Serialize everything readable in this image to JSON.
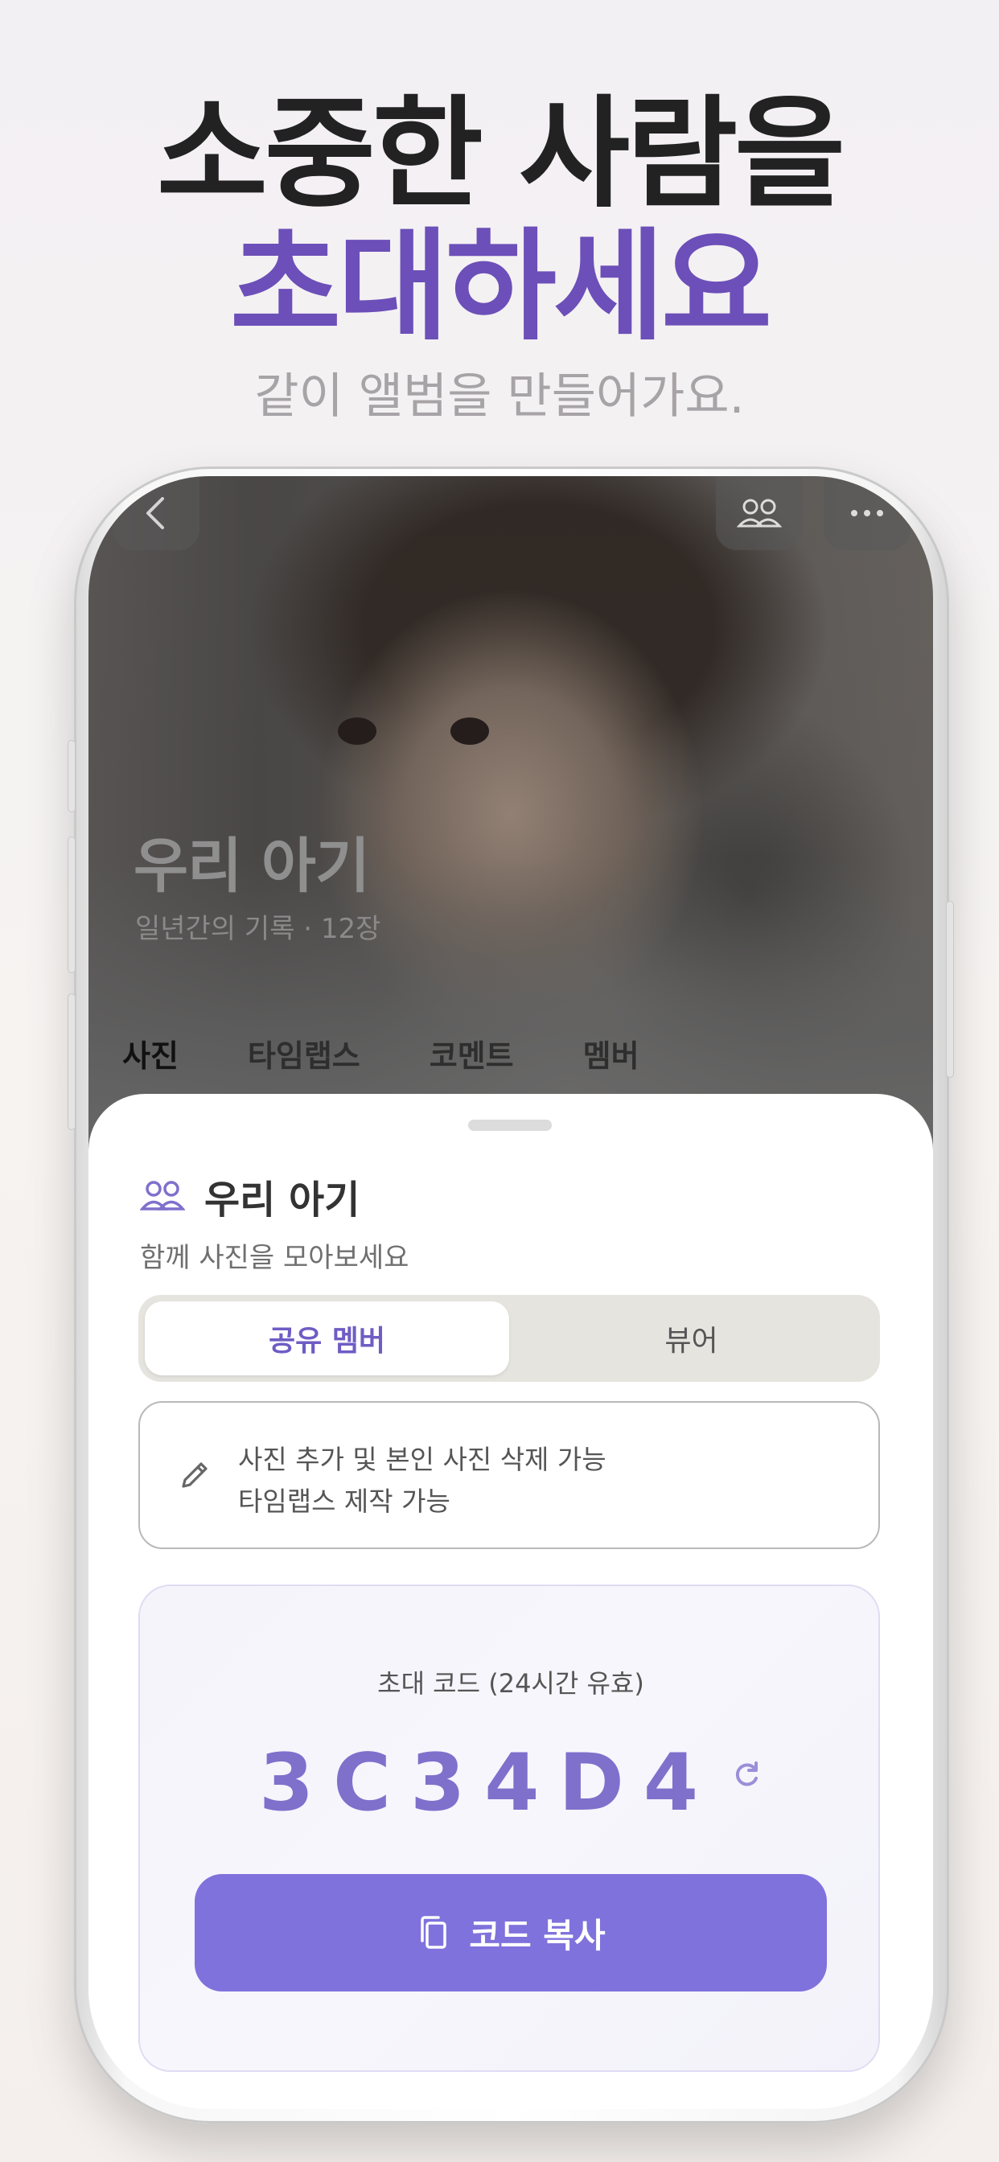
{
  "headline": {
    "line1": "소중한 사람을",
    "line2": "초대하세요",
    "subtitle": "같이 앨범을 만들어가요."
  },
  "album": {
    "title": "우리 아기",
    "subtitle": "일년간의 기록 · 12장",
    "tabs": [
      {
        "label": "사진",
        "active": true
      },
      {
        "label": "타임랩스",
        "active": false
      },
      {
        "label": "코멘트",
        "active": false
      },
      {
        "label": "멤버",
        "active": false
      }
    ]
  },
  "sheet": {
    "title": "우리 아기",
    "subtitle": "함께 사진을 모아보세요",
    "segments": [
      {
        "label": "공유 멤버",
        "active": true
      },
      {
        "label": "뷰어",
        "active": false
      }
    ],
    "permissions": [
      "사진 추가 및 본인 사진 삭제 가능",
      "타임랩스 제작 가능"
    ],
    "invite": {
      "label": "초대 코드 (24시간 유효)",
      "code": "3C34D4",
      "copy_button": "코드 복사"
    }
  },
  "icons": {
    "back": "chevron-left-icon",
    "members": "people-icon",
    "more": "more-horizontal-icon",
    "edit": "pencil-icon",
    "refresh": "refresh-icon",
    "copy": "copy-icon"
  },
  "colors": {
    "accent": "#6c4fb8",
    "button": "#7f72dc",
    "code": "#7f70cc"
  }
}
